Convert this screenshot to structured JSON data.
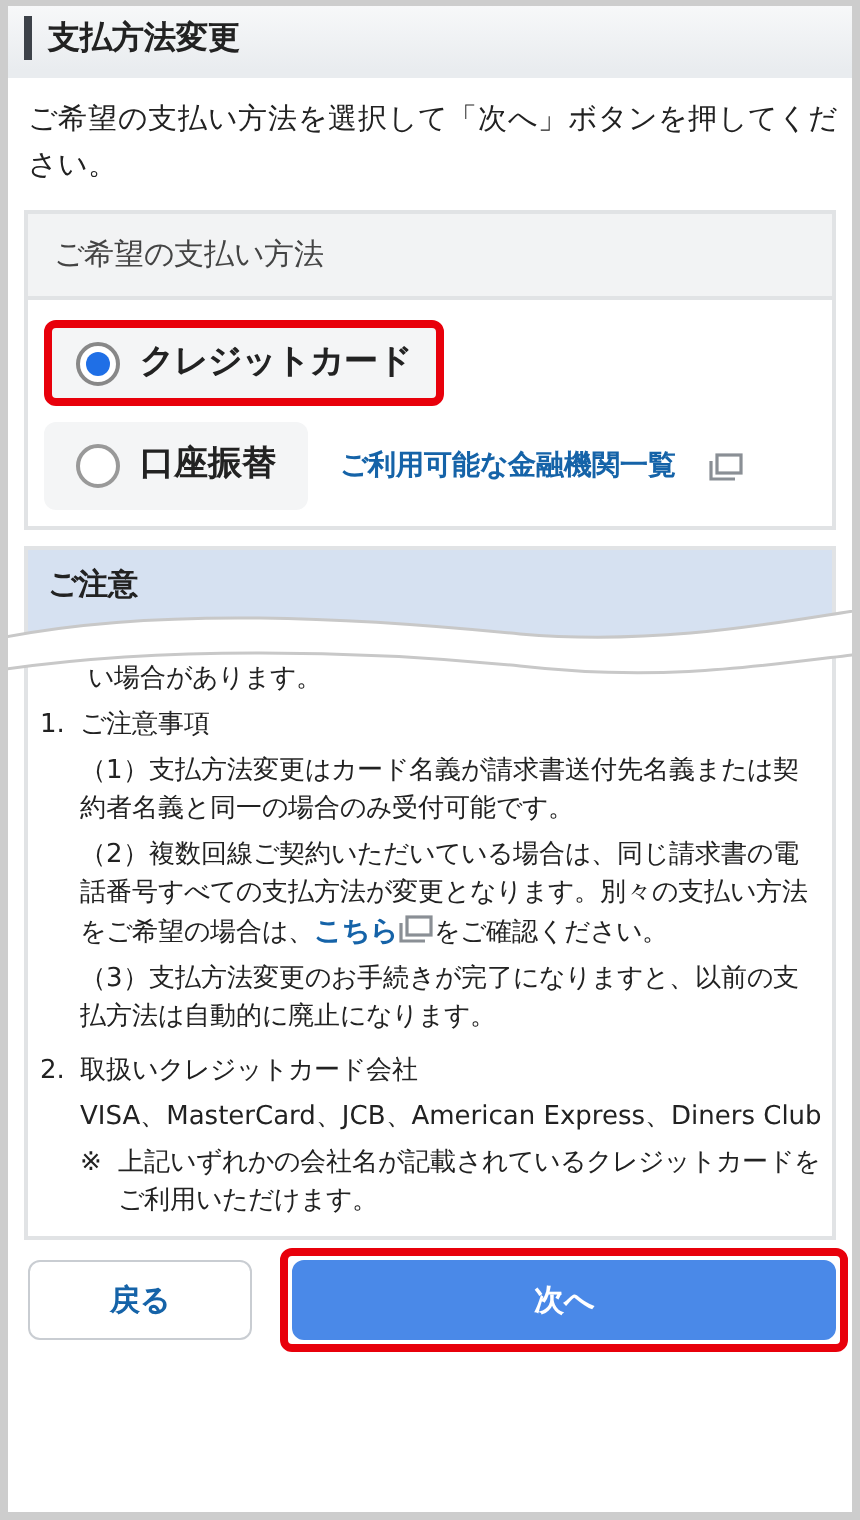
{
  "title": "支払方法変更",
  "intro": "ご希望の支払い方法を選択して「次へ」ボタンを押してください。",
  "method_panel": {
    "heading": "ご希望の支払い方法",
    "options": [
      {
        "label": "クレジットカード",
        "selected": true,
        "highlighted": true
      },
      {
        "label": "口座振替",
        "selected": false,
        "highlighted": false
      }
    ],
    "link": "ご利用可能な金融機関一覧"
  },
  "notice": {
    "heading": "ご注意",
    "fragment": "い場合があります。",
    "items": [
      {
        "number": "1.",
        "title": "ご注意事項",
        "paragraphs": [
          [
            {
              "kind": "text",
              "text": "（1）支払方法変更はカード名義が請求書送付先名義または契約者名義と同一の場合のみ受付可能です。"
            }
          ],
          [
            {
              "kind": "text",
              "text": "（2）複数回線ご契約いただいている場合は、同じ請求書の電話番号すべての支払方法が変更となります。別々の支払い方法をご希望の場合は、"
            },
            {
              "kind": "link",
              "text": "こちら"
            },
            {
              "kind": "text",
              "text": "をご確認ください。"
            }
          ],
          [
            {
              "kind": "text",
              "text": "（3）支払方法変更のお手続きが完了になりますと、以前の支払方法は自動的に廃止になります。"
            }
          ]
        ]
      },
      {
        "number": "2.",
        "title": "取扱いクレジットカード会社",
        "paragraphs": [
          [
            {
              "kind": "text",
              "text": "VISA、MasterCard、JCB、American Express、Diners Club"
            }
          ]
        ],
        "note_mark": "※",
        "note": "上記いずれかの会社名が記載されているクレジットカードをご利用いただけます。"
      }
    ]
  },
  "buttons": [
    {
      "label": "戻る",
      "kind": "secondary",
      "highlighted": false
    },
    {
      "label": "次へ",
      "kind": "primary",
      "highlighted": true
    }
  ]
}
